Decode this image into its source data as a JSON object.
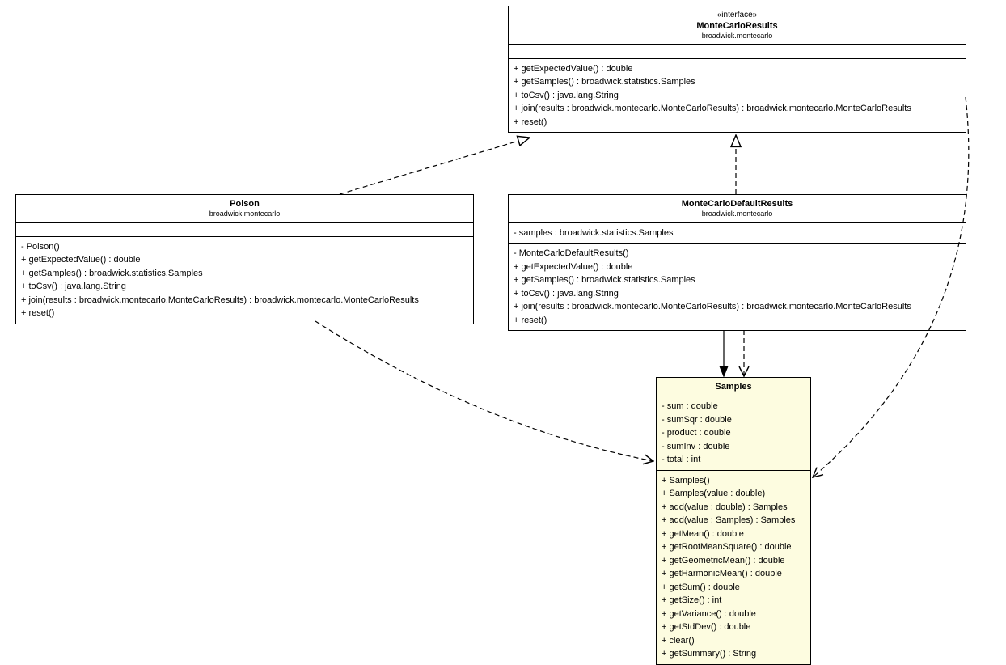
{
  "interface": {
    "stereotype": "«interface»",
    "name": "MonteCarloResults",
    "package": "broadwick.montecarlo",
    "methods": [
      "+ getExpectedValue() : double",
      "+ getSamples() : broadwick.statistics.Samples",
      "+ toCsv() : java.lang.String",
      "+ join(results : broadwick.montecarlo.MonteCarloResults) : broadwick.montecarlo.MonteCarloResults",
      "+ reset()"
    ]
  },
  "poison": {
    "name": "Poison",
    "package": "broadwick.montecarlo",
    "methods": [
      "- Poison()",
      "+ getExpectedValue() : double",
      "+ getSamples() : broadwick.statistics.Samples",
      "+ toCsv() : java.lang.String",
      "+ join(results : broadwick.montecarlo.MonteCarloResults) : broadwick.montecarlo.MonteCarloResults",
      "+ reset()"
    ]
  },
  "defaults": {
    "name": "MonteCarloDefaultResults",
    "package": "broadwick.montecarlo",
    "fields": [
      "- samples : broadwick.statistics.Samples"
    ],
    "methods": [
      "- MonteCarloDefaultResults()",
      "+ getExpectedValue() : double",
      "+ getSamples() : broadwick.statistics.Samples",
      "+ toCsv() : java.lang.String",
      "+ join(results : broadwick.montecarlo.MonteCarloResults) : broadwick.montecarlo.MonteCarloResults",
      "+ reset()"
    ]
  },
  "samples": {
    "name": "Samples",
    "fields": [
      "- sum : double",
      "- sumSqr : double",
      "- product : double",
      "- sumInv : double",
      "- total : int"
    ],
    "methods": [
      "+ Samples()",
      "+ Samples(value : double)",
      "+ add(value : double) : Samples",
      "+ add(value : Samples) : Samples",
      "+ getMean() : double",
      "+ getRootMeanSquare() : double",
      "+ getGeometricMean() : double",
      "+ getHarmonicMean() : double",
      "+ getSum() : double",
      "+ getSize() : int",
      "+ getVariance() : double",
      "+ getStdDev() : double",
      "+ clear()",
      "+ getSummary() : String"
    ]
  }
}
